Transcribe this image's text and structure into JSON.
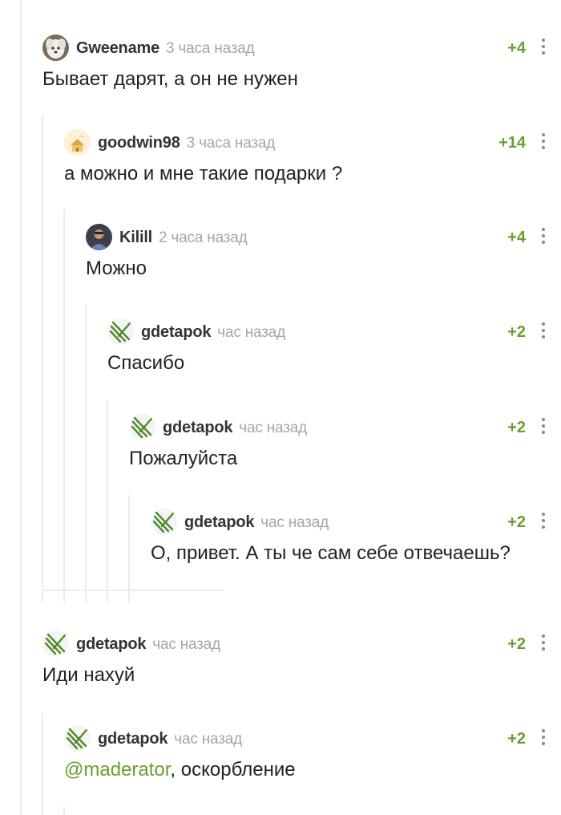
{
  "comments": [
    {
      "author": "Gweename",
      "time": "3 часа назад",
      "rating": "+4",
      "text": "Бывает дарят, а он не нужен"
    },
    {
      "author": "goodwin98",
      "time": "3 часа назад",
      "rating": "+14",
      "text": "а можно и мне такие подарки ?"
    },
    {
      "author": "Kilill",
      "time": "2 часа назад",
      "rating": "+4",
      "text": "Можно"
    },
    {
      "author": "gdetapok",
      "time": "час назад",
      "rating": "+2",
      "text": "Спасибо"
    },
    {
      "author": "gdetapok",
      "time": "час назад",
      "rating": "+2",
      "text": "Пожалуйста"
    },
    {
      "author": "gdetapok",
      "time": "час назад",
      "rating": "+2",
      "text": "О, привет. А ты че сам себе отвечаешь?"
    },
    {
      "author": "gdetapok",
      "time": "час назад",
      "rating": "+2",
      "text": "Иди нахуй"
    },
    {
      "author": "gdetapok",
      "time": "час назад",
      "rating": "+2",
      "mention": "@maderator",
      "text_after_mention": ", оскорбление"
    }
  ],
  "icons": {
    "avatar_gdetapok": "green-diagonal-lines-icon",
    "more": "vertical-dots-icon"
  },
  "colors": {
    "rating": "#6b9e2e",
    "mention": "#6b9e2e",
    "time": "#a6a6a6",
    "thread_line": "#ebebeb"
  }
}
